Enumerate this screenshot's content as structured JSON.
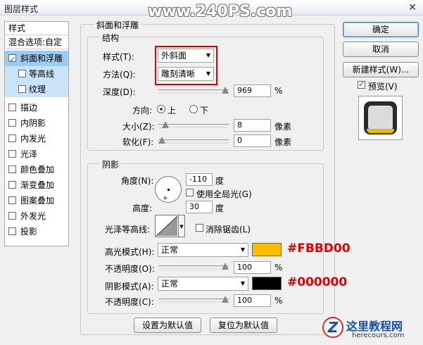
{
  "window": {
    "title": "图层样式",
    "close_glyph": "✕"
  },
  "watermark": "www.240PS.com",
  "sidebar": {
    "header": "样式",
    "blend_options": "混合选项:自定",
    "items": [
      {
        "label": "斜面和浮雕",
        "checked": true
      },
      {
        "label": "等高线",
        "checked": false
      },
      {
        "label": "纹理",
        "checked": false
      },
      {
        "label": "描边",
        "checked": false
      },
      {
        "label": "内阴影",
        "checked": false
      },
      {
        "label": "内发光",
        "checked": false
      },
      {
        "label": "光泽",
        "checked": false
      },
      {
        "label": "颜色叠加",
        "checked": false
      },
      {
        "label": "渐变叠加",
        "checked": false
      },
      {
        "label": "图案叠加",
        "checked": false
      },
      {
        "label": "外发光",
        "checked": false
      },
      {
        "label": "投影",
        "checked": false
      }
    ]
  },
  "bevel": {
    "section_title": "斜面和浮雕",
    "structure_title": "结构",
    "style_label": "样式(T):",
    "style_value": "外斜面",
    "method_label": "方法(Q):",
    "method_value": "雕刻清晰",
    "depth_label": "深度(D):",
    "depth_value": "969",
    "depth_unit": "%",
    "depth_level": 1.0,
    "direction_label": "方向:",
    "dir_up": "上",
    "dir_down": "下",
    "size_label": "大小(Z):",
    "size_value": "8",
    "size_unit": "像素",
    "size_level": 0.05,
    "soften_label": "软化(F):",
    "soften_value": "0",
    "soften_unit": "像素",
    "soften_level": 0.0
  },
  "shading": {
    "title": "阴影",
    "angle_label": "角度(N):",
    "angle_value": "-110",
    "angle_unit": "度",
    "global_light_label": "使用全局光(G)",
    "altitude_label": "高度:",
    "altitude_value": "30",
    "altitude_unit": "度",
    "gloss_label": "光泽等高线:",
    "antialias_label": "消除锯齿(L)",
    "highlight_label": "高光模式(H):",
    "highlight_mode": "正常",
    "highlight_color": "#FBBD00",
    "highlight_hex": "#FBBD00",
    "hl_opacity_label": "不透明度(O):",
    "hl_opacity_value": "100",
    "hl_opacity_unit": "%",
    "shadow_label": "阴影模式(A):",
    "shadow_mode": "正常",
    "shadow_color": "#000000",
    "shadow_hex": "#000000",
    "sh_opacity_label": "不透明度(C):",
    "sh_opacity_value": "100",
    "sh_opacity_unit": "%",
    "make_default": "设置为默认值",
    "reset_default": "复位为默认值"
  },
  "buttons": {
    "ok": "确定",
    "cancel": "取消",
    "new_style": "新建样式(W)...",
    "preview": "预览(V)"
  },
  "footer_logo": {
    "cn": "这里教程网",
    "url": "herecours.com",
    "mark": "Z"
  }
}
